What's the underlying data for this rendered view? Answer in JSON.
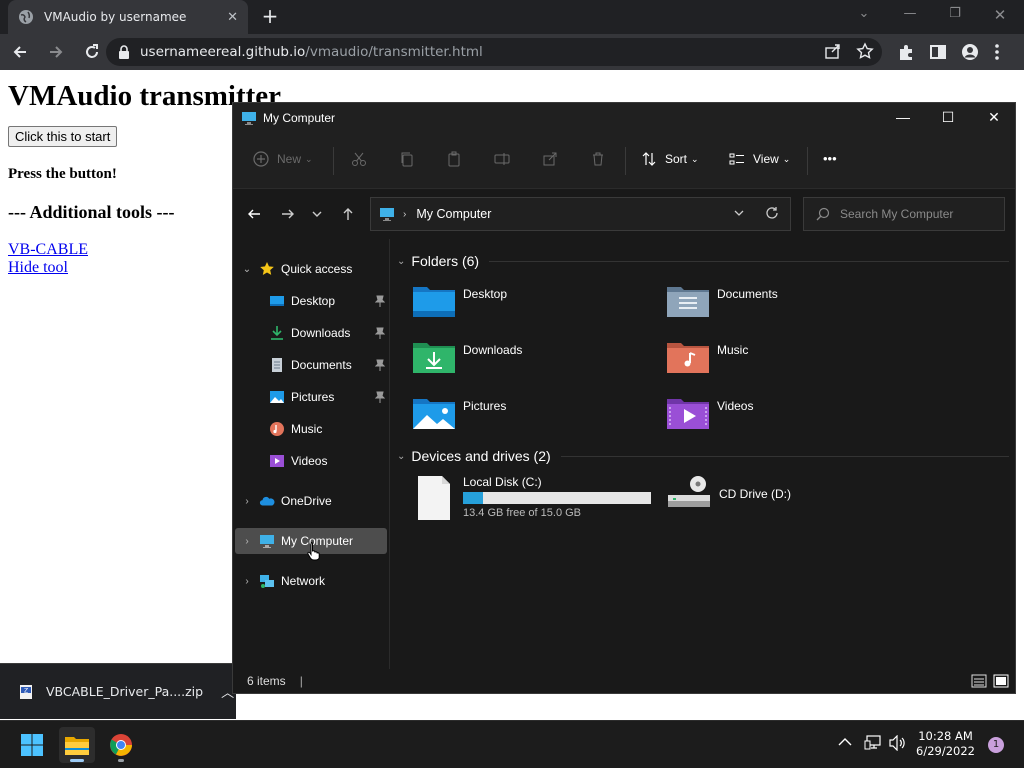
{
  "browser": {
    "tab_title": "VMAudio by usernamee",
    "url_host": "usernameereal.github.io",
    "url_path": "/vmaudio/transmitter.html"
  },
  "page": {
    "heading": "VMAudio transmitter",
    "start_button": "Click this to start",
    "press_text": "Press the button!",
    "additional_tools": "--- Additional tools ---",
    "links": [
      "VB-CABLE",
      "Hide tool"
    ]
  },
  "download": {
    "file_name": "VBCABLE_Driver_Pa....zip"
  },
  "explorer": {
    "title": "My Computer",
    "toolbar": {
      "new": "New",
      "sort": "Sort",
      "view": "View",
      "more": "•••"
    },
    "address": "My Computer",
    "search_placeholder": "Search My Computer",
    "nav": {
      "quick_access": "Quick access",
      "items": [
        "Desktop",
        "Downloads",
        "Documents",
        "Pictures",
        "Music",
        "Videos"
      ],
      "onedrive": "OneDrive",
      "my_computer": "My Computer",
      "network": "Network"
    },
    "folders_header": "Folders (6)",
    "folders": [
      "Desktop",
      "Documents",
      "Downloads",
      "Music",
      "Pictures",
      "Videos"
    ],
    "drives_header": "Devices and drives (2)",
    "drives": [
      {
        "name": "Local Disk (C:)",
        "free": "13.4 GB free of 15.0 GB",
        "used_fraction": 0.107
      },
      {
        "name": "CD Drive (D:)"
      }
    ],
    "status": "6 items"
  },
  "taskbar": {
    "time": "10:28 AM",
    "date": "6/29/2022",
    "notifications": "1"
  },
  "colors": {
    "accent": "#0078d4",
    "folder_blue": "#1e9be9",
    "folder_green": "#2fb56a",
    "folder_music": "#e2745b",
    "folder_video": "#9a4fd6"
  }
}
